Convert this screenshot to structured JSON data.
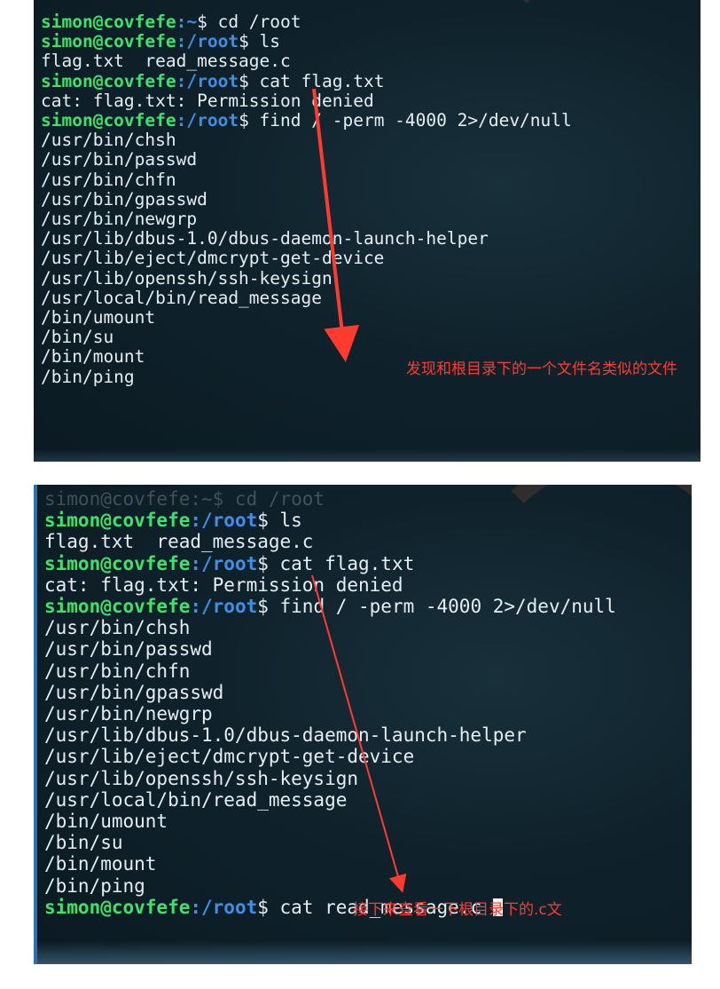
{
  "panel1": {
    "top_partial_line": "simon@covfefe:~$",
    "lines": [
      {
        "user": "simon@covfefe",
        "path": ":~",
        "cmd": "$ cd /root"
      },
      {
        "user": "simon@covfefe",
        "path": ":/root",
        "cmd": "$ ls"
      },
      {
        "text": "flag.txt  read_message.c"
      },
      {
        "user": "simon@covfefe",
        "path": ":/root",
        "cmd": "$ cat flag.txt"
      },
      {
        "text": "cat: flag.txt: Permission denied"
      },
      {
        "user": "simon@covfefe",
        "path": ":/root",
        "cmd": "$ find / -perm -4000 2>/dev/null"
      },
      {
        "text": "/usr/bin/chsh"
      },
      {
        "text": "/usr/bin/passwd"
      },
      {
        "text": "/usr/bin/chfn"
      },
      {
        "text": "/usr/bin/gpasswd"
      },
      {
        "text": "/usr/bin/newgrp"
      },
      {
        "text": "/usr/lib/dbus-1.0/dbus-daemon-launch-helper"
      },
      {
        "text": "/usr/lib/eject/dmcrypt-get-device"
      },
      {
        "text": "/usr/lib/openssh/ssh-keysign"
      },
      {
        "text": "/usr/local/bin/read_message"
      },
      {
        "text": "/bin/umount"
      },
      {
        "text": "/bin/su"
      },
      {
        "text": "/bin/mount"
      },
      {
        "text": "/bin/ping"
      }
    ],
    "annotation": "发现和根目录下的一个文件名类似的文件"
  },
  "panel2": {
    "ghost_line": "simon@covfefe:~$ cd /root",
    "lines": [
      {
        "user": "simon@covfefe",
        "path": ":/root",
        "cmd": "$ ls"
      },
      {
        "text": "flag.txt  read_message.c"
      },
      {
        "user": "simon@covfefe",
        "path": ":/root",
        "cmd": "$ cat flag.txt"
      },
      {
        "text": "cat: flag.txt: Permission denied"
      },
      {
        "user": "simon@covfefe",
        "path": ":/root",
        "cmd": "$ find / -perm -4000 2>/dev/null"
      },
      {
        "text": "/usr/bin/chsh"
      },
      {
        "text": "/usr/bin/passwd"
      },
      {
        "text": "/usr/bin/chfn"
      },
      {
        "text": "/usr/bin/gpasswd"
      },
      {
        "text": "/usr/bin/newgrp"
      },
      {
        "text": "/usr/lib/dbus-1.0/dbus-daemon-launch-helper"
      },
      {
        "text": "/usr/lib/eject/dmcrypt-get-device"
      },
      {
        "text": "/usr/lib/openssh/ssh-keysign"
      },
      {
        "text": "/usr/local/bin/read_message"
      },
      {
        "text": "/bin/umount"
      },
      {
        "text": "/bin/su"
      },
      {
        "text": "/bin/mount"
      },
      {
        "text": "/bin/ping"
      },
      {
        "user": "simon@covfefe",
        "path": ":/root",
        "cmd": "$ cat read_message.c ",
        "cursor": true
      }
    ],
    "annotation": "接下来查看一下根目录下的.c文"
  },
  "colors": {
    "prompt_user": "#3ee26b",
    "prompt_path": "#3d8fe8",
    "annotation": "#ff3b2f",
    "terminal_bg": "#0f222c"
  }
}
